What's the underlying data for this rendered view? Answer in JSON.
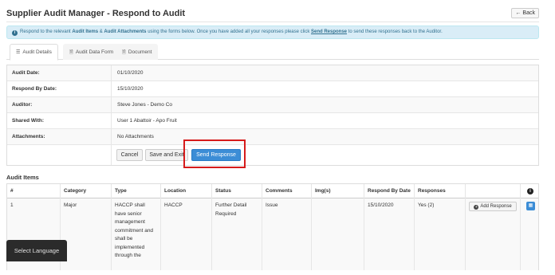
{
  "header": {
    "title": "Supplier Audit Manager - Respond to Audit",
    "back_label": "← Back"
  },
  "alert": {
    "part1": "Respond to the relevant ",
    "bold1": "Audit Items",
    "part2": " & ",
    "bold2": "Audit Attachments",
    "part3": " using the forms below. Once you have added all your responses please click ",
    "link": "Send Response",
    "part4": " to send these responses back to the Auditor."
  },
  "tabs": [
    {
      "label": "Audit Details",
      "icon": "list-icon"
    },
    {
      "label": "Audit Data Form",
      "icon": "document-icon"
    },
    {
      "label": "Document",
      "icon": "document-icon"
    }
  ],
  "details": [
    {
      "label": "Audit Date:",
      "value": "01/10/2020"
    },
    {
      "label": "Respond By Date:",
      "value": "15/10/2020"
    },
    {
      "label": "Auditor:",
      "value": "Steve Jones - Demo Co"
    },
    {
      "label": "Shared With:",
      "value": "User 1 Abattoir - Apo Fruit"
    },
    {
      "label": "Attachments:",
      "value": "No Attachments"
    }
  ],
  "buttons": {
    "cancel": "Cancel",
    "save_exit": "Save and Exit",
    "send": "Send Response"
  },
  "audit_items": {
    "title": "Audit Items",
    "columns": [
      "#",
      "Category",
      "Type",
      "Location",
      "Status",
      "Comments",
      "Img(s)",
      "Respond By Date",
      "Responses",
      "",
      ""
    ],
    "rows": [
      {
        "num": "1",
        "category": "Major",
        "type": "HACCP shall have senior management commitment and shall be implemented through the",
        "location": "HACCP",
        "status": "Further Detail Required",
        "comments": "Issue",
        "imgs": "",
        "respond_by": "15/10/2020",
        "responses": "Yes (2)",
        "add_response": "Add Response"
      }
    ]
  },
  "language": {
    "label": "Select Language"
  },
  "colors": {
    "primary": "#3c8dd6",
    "highlight": "#d61b1b",
    "alert_bg": "#d9edf7",
    "alert_text": "#31708f"
  }
}
